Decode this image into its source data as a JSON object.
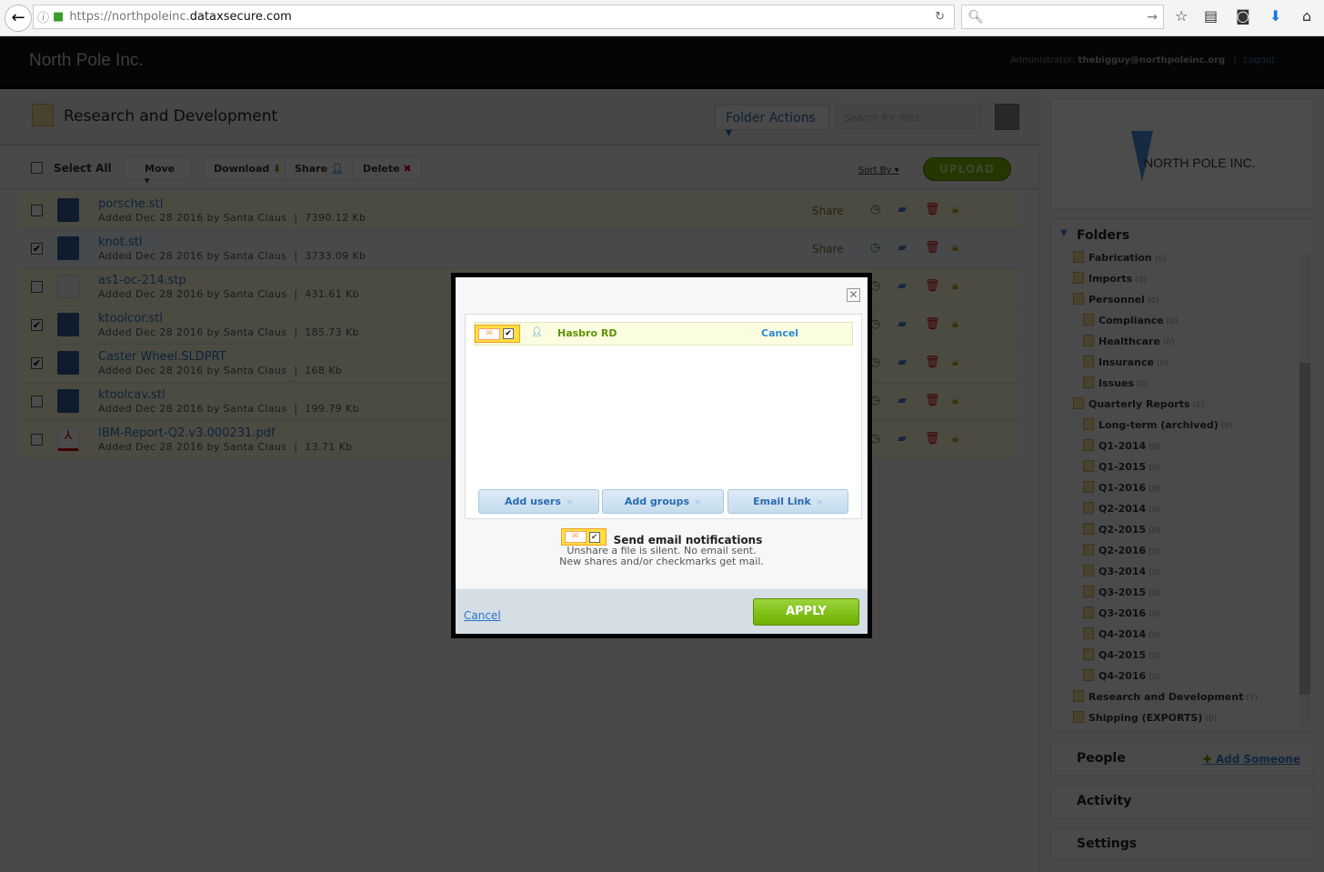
{
  "browser": {
    "url_prefix": "https://northpoleinc.",
    "url_domain": "dataxsecure.com"
  },
  "header": {
    "brand": "North Pole Inc.",
    "admin_label": "Administrator:",
    "admin_email": "thebigguy@northpoleinc.org",
    "separator": "|",
    "logout": "Logout"
  },
  "folder": {
    "title": "Research and Development",
    "actions": "Folder Actions ▾",
    "search_placeholder": "Search for files"
  },
  "toolbar": {
    "select_all": "Select All",
    "move": "Move ▾",
    "download": "Download",
    "share": "Share",
    "delete": "Delete",
    "sort_by": "Sort By ▾",
    "upload": "UPLOAD"
  },
  "files": [
    {
      "name": "porsche.stl",
      "meta": "Added Dec 28 2016 by Santa Claus  |  7390.12 Kb",
      "checked": false,
      "icon": "cad"
    },
    {
      "name": "knot.stl",
      "meta": "Added Dec 28 2016 by Santa Claus  |  3733.09 Kb",
      "checked": true,
      "icon": "cad"
    },
    {
      "name": "as1-oc-214.stp",
      "meta": "Added Dec 28 2016 by Santa Claus  |  431.61 Kb",
      "checked": false,
      "icon": "blank"
    },
    {
      "name": "ktoolcor.stl",
      "meta": "Added Dec 28 2016 by Santa Claus  |  185.73 Kb",
      "checked": true,
      "icon": "cad"
    },
    {
      "name": "Caster Wheel.SLDPRT",
      "meta": "Added Dec 28 2016 by Santa Claus  |  168 Kb",
      "checked": true,
      "icon": "cad"
    },
    {
      "name": "ktoolcav.stl",
      "meta": "Added Dec 28 2016 by Santa Claus  |  199.79 Kb",
      "checked": false,
      "icon": "cad"
    },
    {
      "name": "IBM-Report-Q2.v3.000231.pdf",
      "meta": "Added Dec 28 2016 by Santa Claus  |  13.71 Kb",
      "checked": false,
      "icon": "pdf"
    }
  ],
  "row_share": "Share",
  "sidebar": {
    "logo_text": "NORTH POLE INC.",
    "folders_title": "Folders",
    "folders": [
      {
        "name": "Fabrication",
        "count": "(0)",
        "level": 0
      },
      {
        "name": "Imports",
        "count": "(0)",
        "level": 0
      },
      {
        "name": "Personnel",
        "count": "(0)",
        "level": 0
      },
      {
        "name": "Compliance",
        "count": "(0)",
        "level": 1
      },
      {
        "name": "Healthcare",
        "count": "(0)",
        "level": 1
      },
      {
        "name": "Insurance",
        "count": "(0)",
        "level": 1
      },
      {
        "name": "Issues",
        "count": "(0)",
        "level": 1
      },
      {
        "name": "Quarterly Reports",
        "count": "(0)",
        "level": 0
      },
      {
        "name": "Long-term (archived)",
        "count": "(0)",
        "level": 1
      },
      {
        "name": "Q1-2014",
        "count": "(0)",
        "level": 1
      },
      {
        "name": "Q1-2015",
        "count": "(0)",
        "level": 1
      },
      {
        "name": "Q1-2016",
        "count": "(0)",
        "level": 1
      },
      {
        "name": "Q2-2014",
        "count": "(0)",
        "level": 1
      },
      {
        "name": "Q2-2015",
        "count": "(0)",
        "level": 1
      },
      {
        "name": "Q2-2016",
        "count": "(0)",
        "level": 1
      },
      {
        "name": "Q3-2014",
        "count": "(0)",
        "level": 1
      },
      {
        "name": "Q3-2015",
        "count": "(0)",
        "level": 1
      },
      {
        "name": "Q3-2016",
        "count": "(0)",
        "level": 1
      },
      {
        "name": "Q4-2014",
        "count": "(0)",
        "level": 1
      },
      {
        "name": "Q4-2015",
        "count": "(0)",
        "level": 1
      },
      {
        "name": "Q4-2016",
        "count": "(0)",
        "level": 1
      },
      {
        "name": "Research and Development",
        "count": "(7)",
        "level": 0
      },
      {
        "name": "Shipping (EXPORTS)",
        "count": "(0)",
        "level": 0
      }
    ],
    "people": "People",
    "add_someone": "Add Someone",
    "activity": "Activity",
    "settings": "Settings"
  },
  "modal": {
    "close": "✕",
    "share_user": "Hasbro RD",
    "share_cancel": "Cancel",
    "add_users": "Add users",
    "add_groups": "Add groups",
    "email_link": "Email Link",
    "notif_title": "Send email notifications",
    "notif_line1": "Unshare a file is silent. No email sent.",
    "notif_line2": "New shares and/or checkmarks get mail.",
    "cancel": "Cancel",
    "apply": "APPLY"
  }
}
